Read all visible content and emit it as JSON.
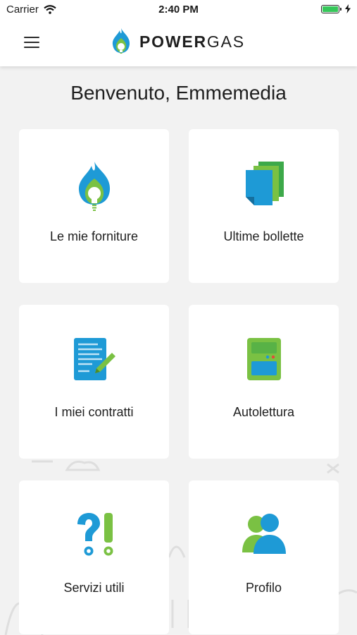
{
  "status_bar": {
    "carrier": "Carrier",
    "time": "2:40 PM"
  },
  "nav": {
    "brand_bold": "POWER",
    "brand_light": "GAS"
  },
  "welcome": "Benvenuto, Emmemedia",
  "colors": {
    "accent_blue": "#1e9ad6",
    "accent_green": "#7ac143",
    "background": "#f2f2f2"
  },
  "tiles": [
    {
      "label": "Le mie forniture",
      "icon": "flame-bulb-icon"
    },
    {
      "label": "Ultime bollette",
      "icon": "bills-stack-icon"
    },
    {
      "label": "I miei contratti",
      "icon": "contract-pen-icon"
    },
    {
      "label": "Autolettura",
      "icon": "meter-icon"
    },
    {
      "label": "Servizi utili",
      "icon": "question-exclamation-icon"
    },
    {
      "label": "Profilo",
      "icon": "users-icon"
    }
  ]
}
